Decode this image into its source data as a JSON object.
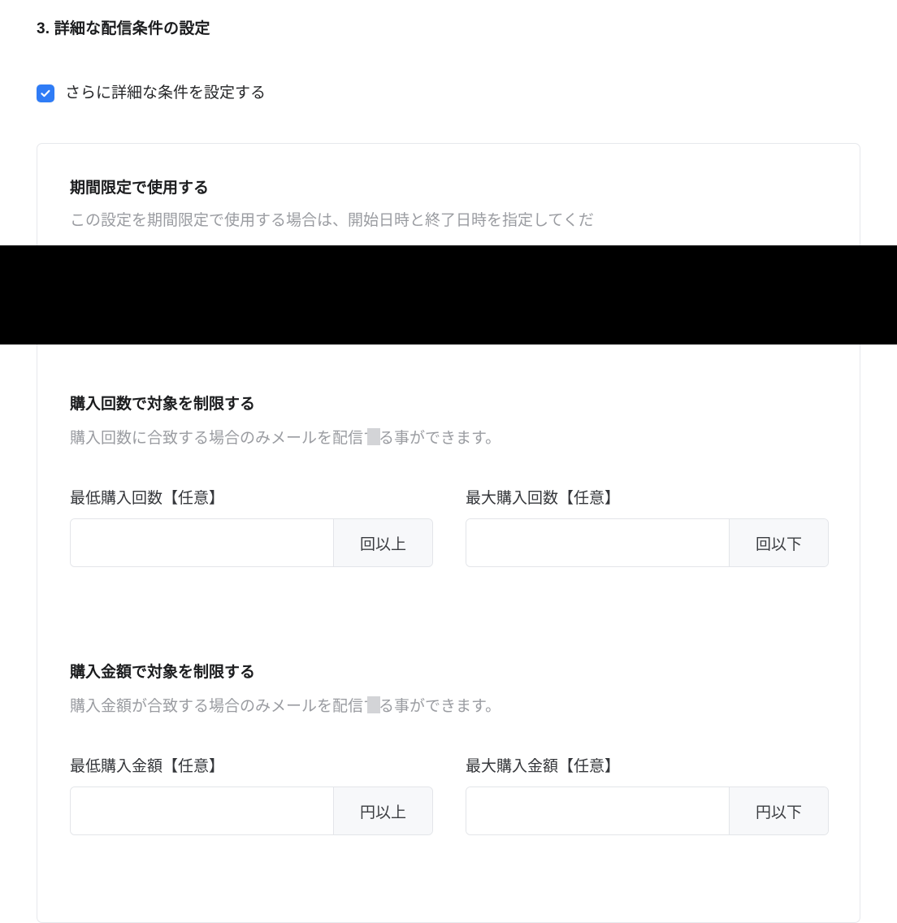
{
  "page": {
    "background_color": "#ffffff",
    "accent_color": "#2f7cf6",
    "border_color": "#e6e8ec",
    "muted_text_color": "#9a9ca1"
  },
  "step": {
    "heading": "3. 詳細な配信条件の設定"
  },
  "advanced_toggle": {
    "label": "さらに詳細な条件を設定する",
    "checked": true,
    "checkmark_icon": "check-icon"
  },
  "card": {
    "sections": [
      {
        "id": "period",
        "title": "期間限定で使用する",
        "description": "この設定を期間限定で使用する場合は、開始日時と終了日時を指定してくだ"
      },
      {
        "id": "purchase_count",
        "title": "購入回数で対象を制限する",
        "description": "購入回数に合致する場合のみメールを配信する事ができます。",
        "fields": [
          {
            "id": "min_purchase_count",
            "label": "最低購入回数【任意】",
            "value": "",
            "placeholder": "",
            "addon": "回以上"
          },
          {
            "id": "max_purchase_count",
            "label": "最大購入回数【任意】",
            "value": "",
            "placeholder": "",
            "addon": "回以下"
          }
        ]
      },
      {
        "id": "purchase_amount",
        "title": "購入金額で対象を制限する",
        "description": "購入金額が合致する場合のみメールを配信する事ができます。",
        "fields": [
          {
            "id": "min_purchase_amount",
            "label": "最低購入金額【任意】",
            "value": "",
            "placeholder": "",
            "addon": "円以上"
          },
          {
            "id": "max_purchase_amount",
            "label": "最大購入金額【任意】",
            "value": "",
            "placeholder": "",
            "addon": "円以下"
          }
        ]
      }
    ]
  }
}
